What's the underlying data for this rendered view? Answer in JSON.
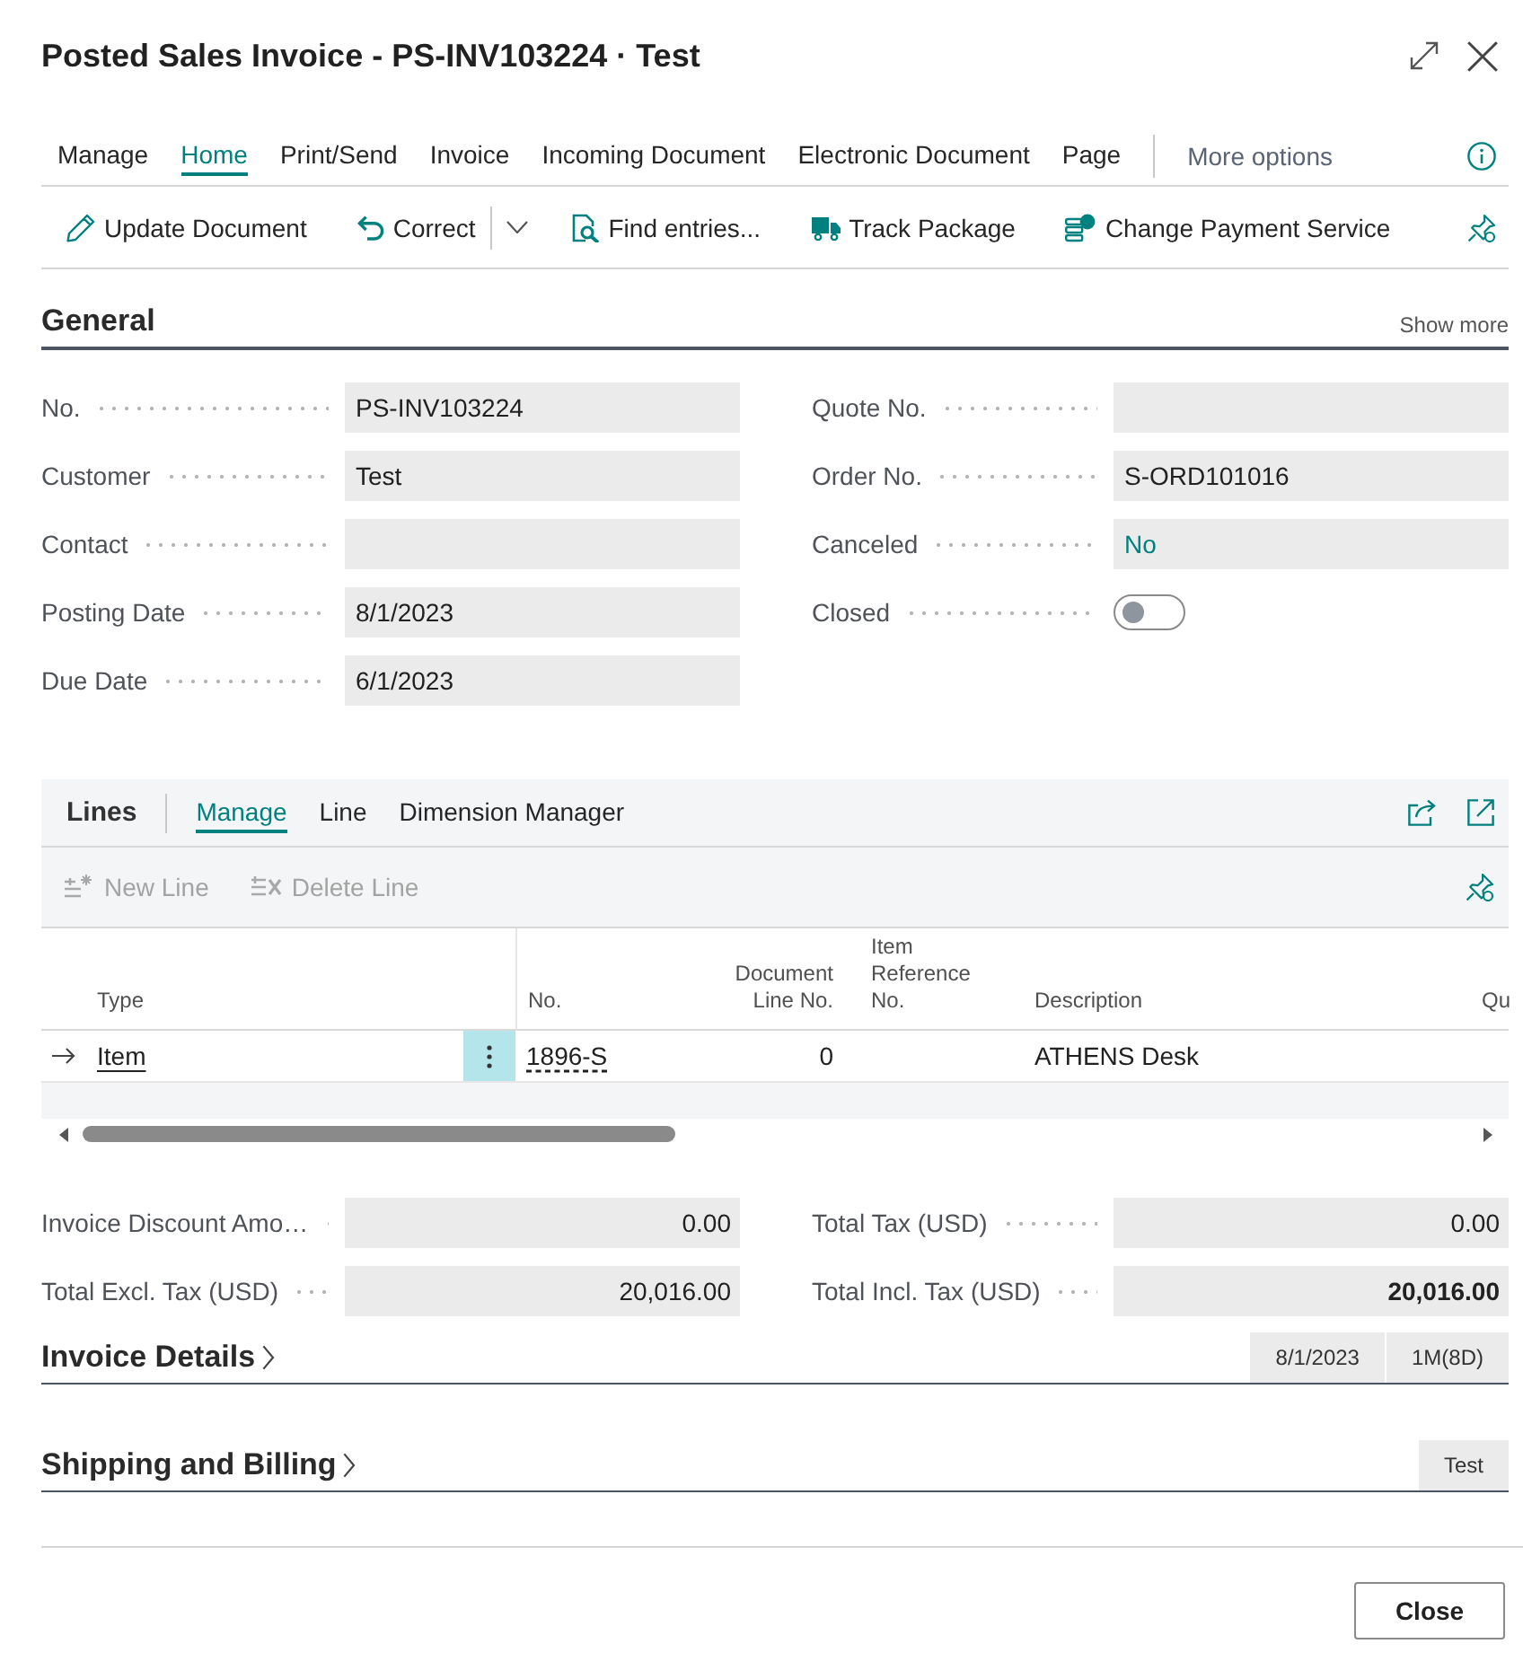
{
  "window": {
    "title": "Posted Sales Invoice - PS-INV103224 · Test"
  },
  "action_bar": {
    "tabs": [
      {
        "label": "Manage",
        "selected": false
      },
      {
        "label": "Home",
        "selected": true
      },
      {
        "label": "Print/Send",
        "selected": false
      },
      {
        "label": "Invoice",
        "selected": false
      },
      {
        "label": "Incoming Document",
        "selected": false
      },
      {
        "label": "Electronic Document",
        "selected": false
      },
      {
        "label": "Page",
        "selected": false
      }
    ],
    "more_options": "More options",
    "actions": [
      {
        "label": "Update Document"
      },
      {
        "label": "Correct",
        "split": true
      },
      {
        "label": "Find entries..."
      },
      {
        "label": "Track Package"
      },
      {
        "label": "Change Payment Service"
      }
    ]
  },
  "general": {
    "title": "General",
    "show_more": "Show more",
    "left_fields": [
      {
        "label": "No.",
        "value": "PS-INV103224",
        "kind": "text"
      },
      {
        "label": "Customer",
        "value": "Test",
        "kind": "text"
      },
      {
        "label": "Contact",
        "kind": "text"
      },
      {
        "label": "Posting Date",
        "value": "8/1/2023",
        "kind": "text"
      },
      {
        "label": "Due Date",
        "value": "6/1/2023",
        "kind": "text"
      }
    ],
    "right_fields": [
      {
        "label": "Quote No.",
        "kind": "text"
      },
      {
        "label": "Order No.",
        "value": "S-ORD101016",
        "kind": "text"
      },
      {
        "label": "Canceled",
        "value": "No",
        "kind": "link"
      },
      {
        "label": "Closed",
        "kind": "toggle",
        "on": false
      }
    ]
  },
  "lines": {
    "title": "Lines",
    "tabs": [
      {
        "label": "Manage",
        "selected": true
      },
      {
        "label": "Line",
        "selected": false
      },
      {
        "label": "Dimension Manager",
        "selected": false
      }
    ],
    "actions": [
      {
        "label": "New Line",
        "disabled": true
      },
      {
        "label": "Delete Line",
        "disabled": true
      }
    ],
    "columns": [
      "Type",
      "No.",
      "Document Line No.",
      "Item Reference No.",
      "Description",
      "Qu"
    ],
    "rows": [
      {
        "current": true,
        "type": "Item",
        "no": "1896-S",
        "document_line_no": "0",
        "description": "ATHENS Desk"
      }
    ]
  },
  "totals": {
    "left_fields": [
      {
        "label": "Invoice Discount Amo…",
        "value": "0.00",
        "kind": "amount"
      },
      {
        "label": "Total Excl. Tax (USD)",
        "value": "20,016.00",
        "kind": "amount"
      }
    ],
    "right_fields": [
      {
        "label": "Total Tax (USD)",
        "value": "0.00",
        "kind": "amount"
      },
      {
        "label": "Total Incl. Tax (USD)",
        "value": "20,016.00",
        "kind": "total"
      }
    ]
  },
  "fasttabs": [
    {
      "title": "Invoice Details",
      "expanded": false,
      "summary": [
        "8/1/2023",
        "1M(8D)"
      ]
    },
    {
      "title": "Shipping and Billing",
      "expanded": false,
      "summary": [
        "Test"
      ]
    }
  ],
  "buttons": [
    "Close"
  ]
}
